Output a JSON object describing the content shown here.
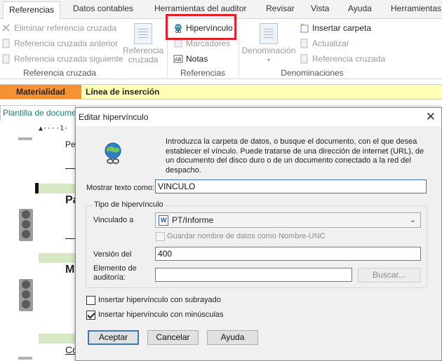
{
  "ribbon_tabs": [
    "Referencias",
    "Datos contables",
    "Herramientas del auditor",
    "Revisar",
    "Vista",
    "Ayuda",
    "Herramientas"
  ],
  "ribbon": {
    "referencia_cruzada_group": {
      "items": [
        "Eliminar referencia cruzada",
        "Referencia cruzada anterior",
        "Referencia cruzada siguiente"
      ],
      "big_button": "Referencia\ncruzada",
      "label": "Referencia cruzada"
    },
    "referencias_group": {
      "hipervinculo": "Hipervínculo",
      "marcadores": "Marcadores",
      "notas": "Notas",
      "label": "Referencias"
    },
    "denominaciones_group": {
      "big_button": "Denominación",
      "insertar_carpeta": "Insertar carpeta",
      "actualizar": "Actualizar",
      "referencia_cruzada": "Referencia cruzada",
      "label": "Denominaciones"
    }
  },
  "matbar": {
    "materialidad": "Materialidad",
    "linea": "Línea de inserción"
  },
  "document": {
    "tab_label": "Plantilla de documentos",
    "ruler": "▲····1·",
    "texts": [
      "Pe",
      "Pa",
      "Mi",
      "Co"
    ]
  },
  "dialog": {
    "title": "Editar hipervínculo",
    "intro": "Introduzca la carpeta de datos, o busque el documento, con el que desea establecer el vínculo. Puede tratarse de una dirección de internet (URL), de un documento del disco duro o de un documento conectado a la red del despacho.",
    "mostrar_label": "Mostrar texto como:",
    "mostrar_value": "VINCULO",
    "tipo_legend": "Tipo de hipervínculo",
    "vinculado_label": "Vinculado a",
    "vinculado_value": "PT/Informe",
    "guardar_unc": "Guardar nombre de datos como Nombre-UNC",
    "version_label": "Versión del",
    "version_value": "400",
    "elemento_label": "Elemento de\nauditoría:",
    "elemento_value": "",
    "buscar": "Buscar...",
    "subrayado": "Insertar hipervínculo con subrayado",
    "minusculas": "Insertar hipervínculo con minúsculas",
    "aceptar": "Aceptar",
    "cancelar": "Cancelar",
    "ayuda": "Ayuda"
  },
  "colors": {
    "accent": "#3d7ab5",
    "highlight": "#e3202a",
    "materialidad": "#f79232",
    "linea": "#ffffb5"
  }
}
